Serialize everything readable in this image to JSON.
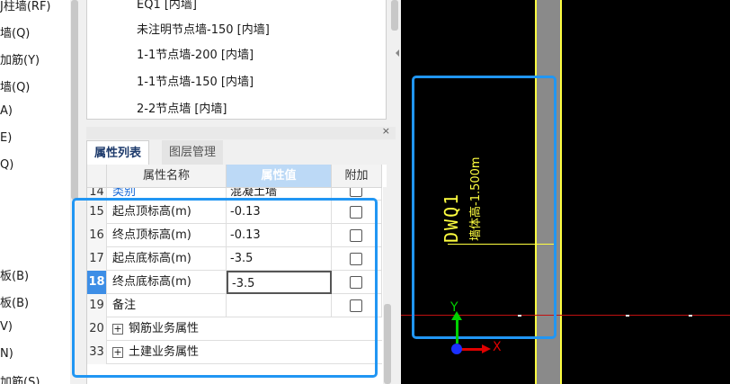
{
  "left_nav": {
    "items": [
      "J柱墙(RF)",
      "墙(Q)",
      "加筋(Y)",
      "墙(Q)",
      "A)",
      "E)",
      "Q)",
      "板(B)",
      "板(B)",
      "V)",
      "N)",
      "加筋(S)"
    ]
  },
  "node_list": {
    "items": [
      "EQ1 [内墙]",
      "未注明节点墙-150 [内墙]",
      "1-1节点墙-200 [内墙]",
      "1-1节点墙-150 [内墙]",
      "2-2节点墙 [内墙]"
    ]
  },
  "panel": {
    "close_label": "×",
    "tabs": [
      {
        "label": "属性列表",
        "active": true
      },
      {
        "label": "图层管理",
        "active": false
      }
    ],
    "columns": {
      "name": "属性名称",
      "value": "属性值",
      "extra": "附加"
    },
    "rows": [
      {
        "num": "14",
        "name": "类别",
        "value": "混凝土墙",
        "has_checkbox": true,
        "checked": false
      },
      {
        "num": "15",
        "name": "起点顶标高(m)",
        "value": "-0.13",
        "has_checkbox": true,
        "checked": false
      },
      {
        "num": "16",
        "name": "终点顶标高(m)",
        "value": "-0.13",
        "has_checkbox": true,
        "checked": false
      },
      {
        "num": "17",
        "name": "起点底标高(m)",
        "value": "-3.5",
        "has_checkbox": true,
        "checked": false
      },
      {
        "num": "18",
        "name": "终点底标高(m)",
        "value": "-3.5",
        "has_checkbox": true,
        "checked": false,
        "active": true
      },
      {
        "num": "19",
        "name": "备注",
        "value": "",
        "has_checkbox": true,
        "checked": false
      }
    ],
    "groups": [
      {
        "num": "20",
        "expander": "+",
        "name": "钢筋业务属性"
      },
      {
        "num": "33",
        "expander": "+",
        "name": "土建业务属性"
      }
    ]
  },
  "canvas": {
    "wall_code": "DWQ1",
    "wall_height": "墙体高-1.500m",
    "axis_x": "X",
    "axis_y": "Y",
    "colors": {
      "background": "#000000",
      "annotation": "#ffff40",
      "selection": "#2196f3",
      "axis_x": "#e00000",
      "axis_y": "#00d000"
    }
  },
  "icons": [
    "close-icon",
    "collapse-arrow-icon",
    "expand-plus-icon",
    "axis-origin-icon",
    "axis-x-arrow-icon",
    "axis-y-arrow-icon"
  ]
}
